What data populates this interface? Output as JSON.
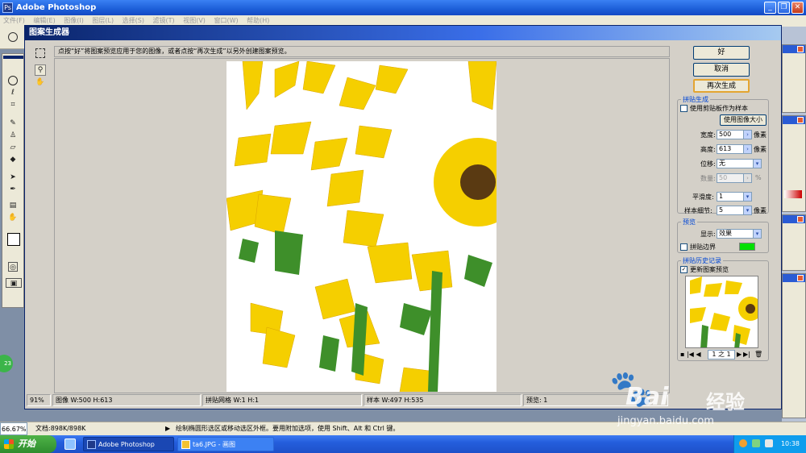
{
  "app": {
    "title": "Adobe Photoshop",
    "icon": "photoshop-icon"
  },
  "menu": [
    "文件(F)",
    "编辑(E)",
    "图像(I)",
    "图层(L)",
    "选择(S)",
    "滤镜(T)",
    "视图(V)",
    "窗口(W)",
    "帮助(H)"
  ],
  "dialog": {
    "title": "图案生成器",
    "hint": "点按“好”将图案预览应用于您的图像，或者点按“再次生成”以另外创建图案预览。",
    "buttons": {
      "ok": "好",
      "cancel": "取消",
      "regenerate": "再次生成"
    }
  },
  "tile_generation": {
    "group_title": "拼贴生成",
    "use_clipboard_label": "使用剪贴板作为样本",
    "use_image_size_button": "使用图像大小",
    "width_label": "宽度:",
    "width_value": "500",
    "width_unit": "像素",
    "height_label": "高度:",
    "height_value": "613",
    "height_unit": "像素",
    "offset_label": "位移:",
    "offset_value": "无",
    "amount_label": "数量:",
    "amount_value": "50",
    "amount_unit": "%",
    "smoothness_label": "平滑度:",
    "smoothness_value": "1",
    "sample_detail_label": "样本细节:",
    "sample_detail_value": "5",
    "sample_detail_unit": "像素"
  },
  "preview_group": {
    "group_title": "预览",
    "show_label": "显示:",
    "show_value": "效果",
    "tile_boundaries_label": "拼贴边界",
    "boundary_color": "#00e000"
  },
  "history": {
    "group_title": "拼贴历史记录",
    "update_preview_label": "更新图案预览",
    "current": "1",
    "of": "之",
    "total": "1"
  },
  "status": {
    "zoom": "91%",
    "image": "图像 W:500  H:613",
    "grid": "拼贴网格 W:1  H:1",
    "sample": "样本 W:497  H:535",
    "preview": "预览: 1"
  },
  "ps_status": {
    "zoom": "66.67%",
    "doc": "文档:898K/898K",
    "hint": "绘制椭圆形选区或移动选区外框。要用附加选项，使用 Shift、Alt 和 Ctrl 键。"
  },
  "taskbar": {
    "start": "开始",
    "tasks": [
      "Adobe Photoshop",
      "ta6.JPG - 画图"
    ],
    "clock": "10:38"
  },
  "watermark": {
    "brand": "Bai",
    "brand2": "经验",
    "url": "jingyan.baidu.com"
  },
  "badge": "23",
  "colors": {
    "title_blue": "#0a246a",
    "accent_blue": "#0046d5",
    "sunflower": "#f5d400"
  }
}
